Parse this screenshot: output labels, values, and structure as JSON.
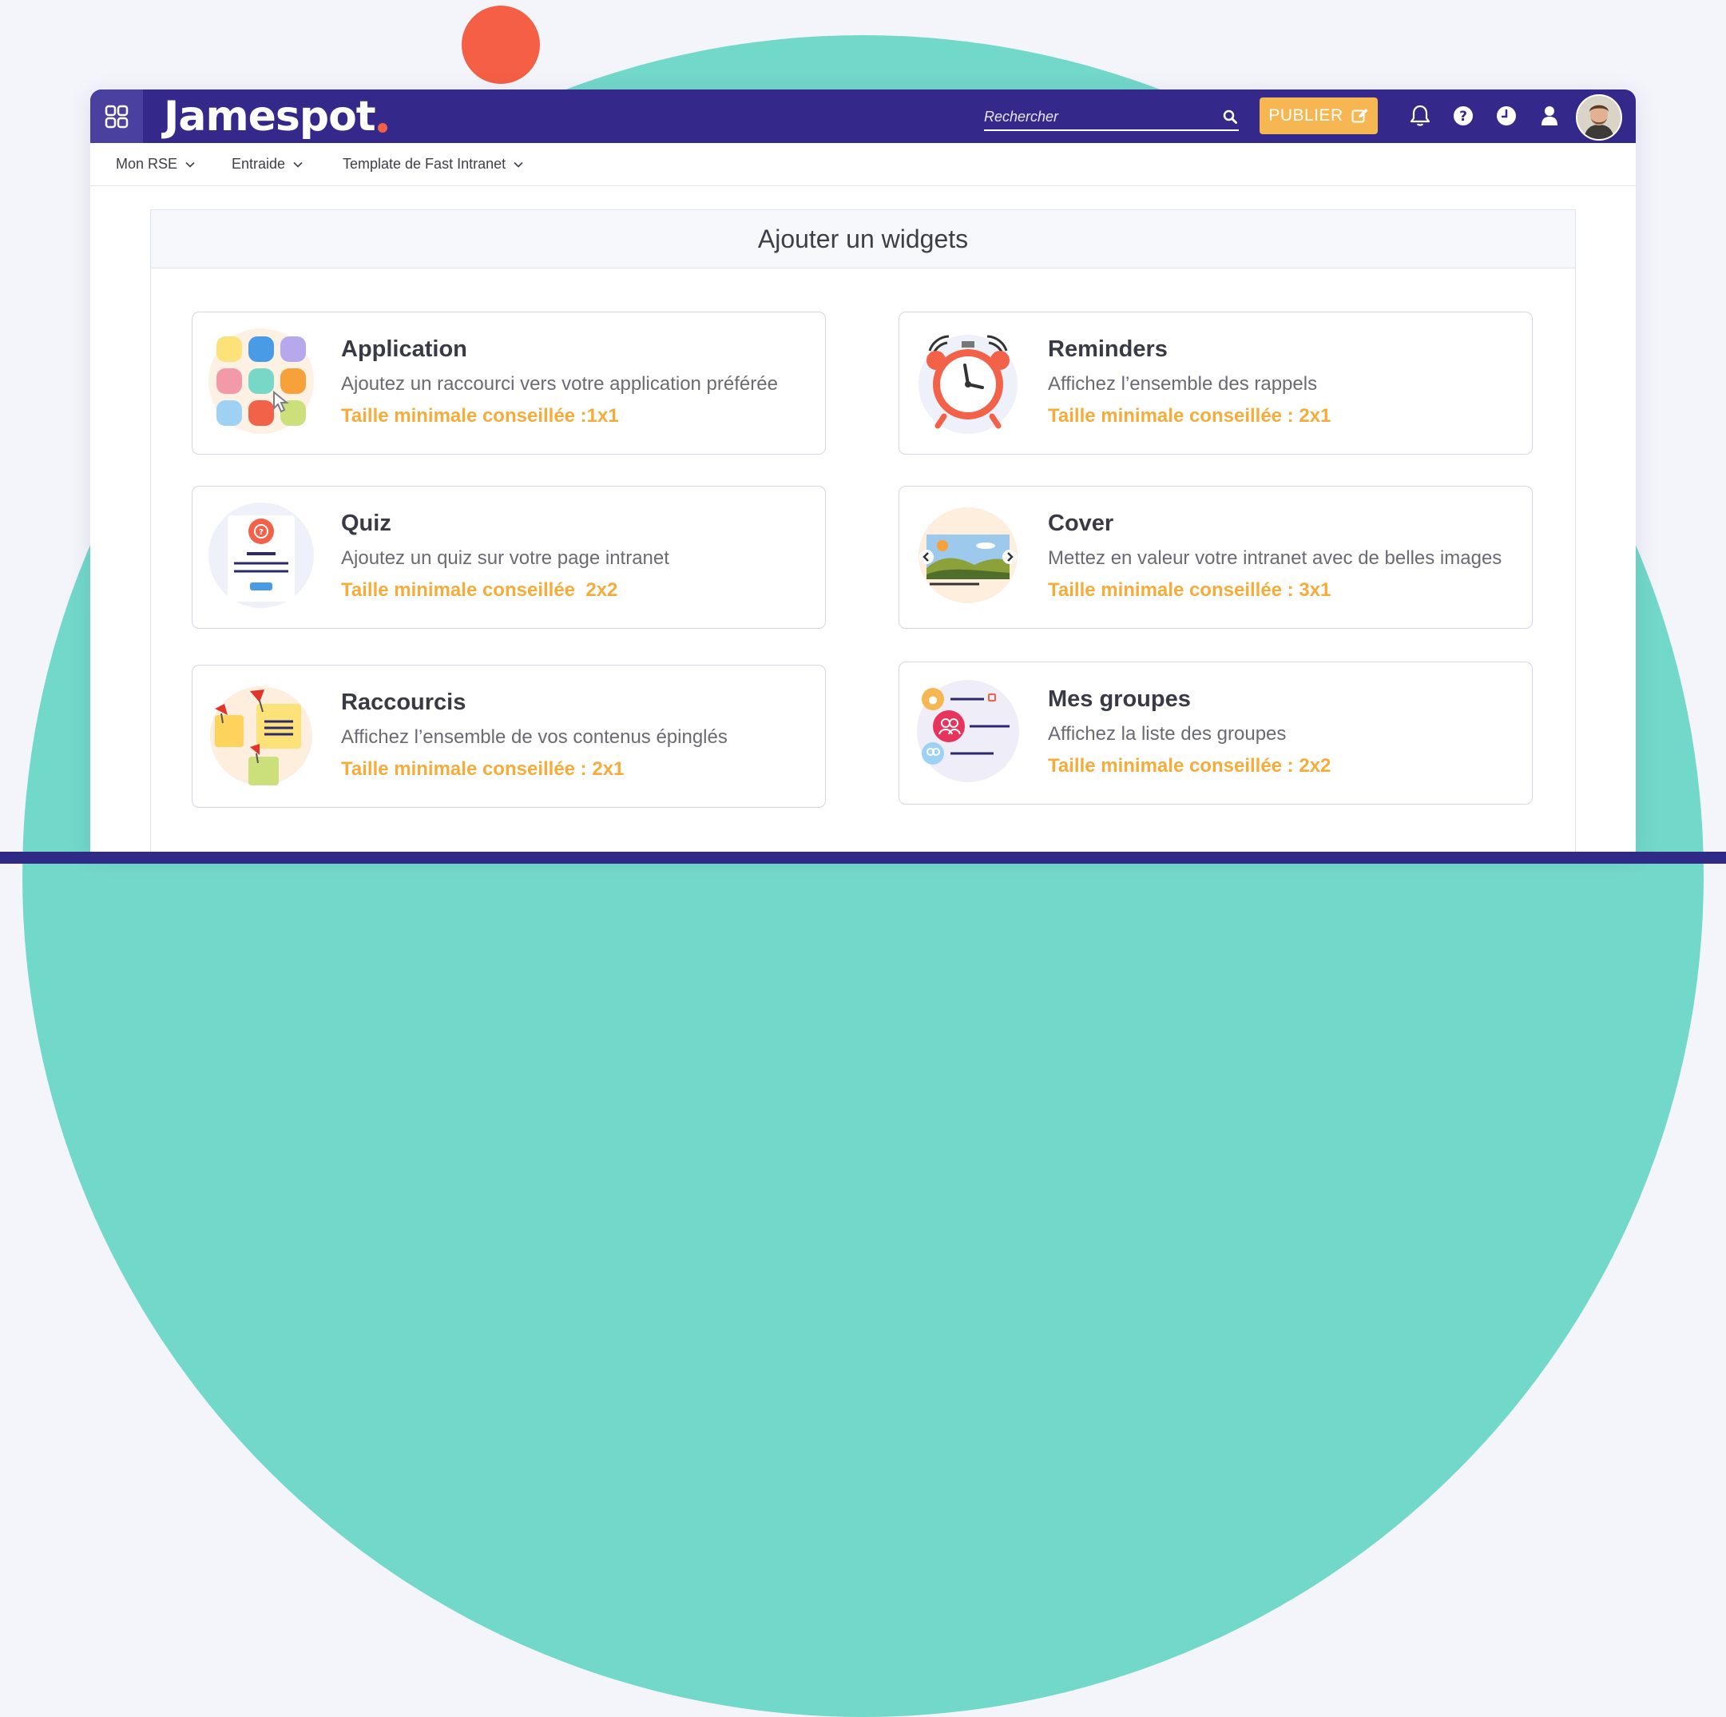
{
  "app": {
    "logo_text": "Jamespot"
  },
  "header": {
    "search_placeholder": "Rechercher",
    "publish_label": "PUBLIER",
    "icons": [
      "apps-grid-icon",
      "search-icon",
      "edit-icon",
      "bell-icon",
      "help-icon",
      "clock-icon",
      "user-icon",
      "avatar"
    ]
  },
  "nav": {
    "items": [
      {
        "label": "Mon RSE"
      },
      {
        "label": "Entraide"
      },
      {
        "label": "Template de Fast Intranet"
      }
    ]
  },
  "panel": {
    "title": "Ajouter un widgets",
    "widgets": [
      {
        "title": "Application",
        "description": "Ajoutez un raccourci vers votre application préférée",
        "size": "Taille minimale conseillée :1x1",
        "icon": "apps-icon"
      },
      {
        "title": "Reminders",
        "description": "Affichez l’ensemble des rappels",
        "size": "Taille minimale conseillée : 2x1",
        "icon": "alarm-clock-icon"
      },
      {
        "title": "Quiz",
        "description": "Ajoutez un quiz sur votre page intranet",
        "size": "Taille minimale conseillée  2x2",
        "icon": "quiz-icon"
      },
      {
        "title": "Cover",
        "description": "Mettez en valeur votre intranet avec de belles images",
        "size": "Taille minimale conseillée : 3x1",
        "icon": "image-slider-icon"
      },
      {
        "title": "Raccourcis",
        "description": "Affichez l’ensemble de vos contenus épinglés",
        "size": "Taille minimale conseillée : 2x1",
        "icon": "pinned-notes-icon"
      },
      {
        "title": "Mes groupes",
        "description": "Affichez la liste des groupes",
        "size": "Taille minimale conseillée : 2x2",
        "icon": "groups-icon"
      }
    ]
  },
  "colors": {
    "topbar": "#34298a",
    "accent_orange": "#f6b652",
    "size_text": "#f5ac3a",
    "background_circle": "#72d8c9",
    "background_dot": "#f45f45"
  }
}
